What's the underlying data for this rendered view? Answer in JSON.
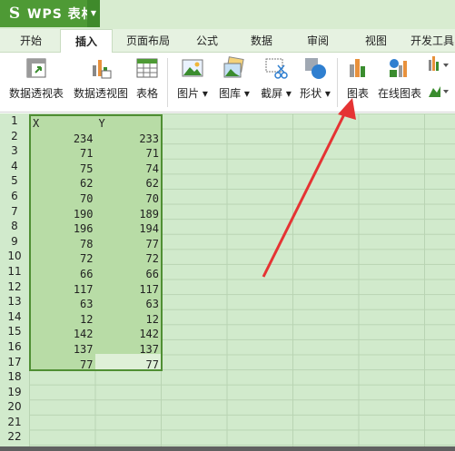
{
  "app": {
    "title": "WPS 表格",
    "logo": "S"
  },
  "tabs": [
    "开始",
    "插入",
    "页面布局",
    "公式",
    "数据",
    "审阅",
    "视图",
    "开发工具"
  ],
  "active_tab": "插入",
  "ribbon": {
    "pivot_table": "数据透视表",
    "pivot_chart": "数据透视图",
    "table": "表格",
    "picture": "图片",
    "gallery": "图库",
    "screenshot": "截屏",
    "shape": "形状",
    "chart": "图表",
    "online_chart": "在线图表",
    "dropdown_caret": "▾"
  },
  "sheet": {
    "row_numbers": [
      "1",
      "2",
      "3",
      "4",
      "5",
      "6",
      "7",
      "8",
      "9",
      "10",
      "11",
      "12",
      "13",
      "14",
      "15",
      "16",
      "17",
      "18",
      "19",
      "20",
      "21",
      "22"
    ],
    "headers": [
      "X",
      "Y"
    ],
    "rows": [
      [
        "234",
        "233"
      ],
      [
        "71",
        "71"
      ],
      [
        "75",
        "74"
      ],
      [
        "62",
        "62"
      ],
      [
        "70",
        "70"
      ],
      [
        "190",
        "189"
      ],
      [
        "196",
        "194"
      ],
      [
        "78",
        "77"
      ],
      [
        "72",
        "72"
      ],
      [
        "66",
        "66"
      ],
      [
        "117",
        "117"
      ],
      [
        "63",
        "63"
      ],
      [
        "12",
        "12"
      ],
      [
        "142",
        "142"
      ],
      [
        "137",
        "137"
      ],
      [
        "77",
        "77"
      ]
    ]
  },
  "colors": {
    "accent": "#4e9a35",
    "arrow": "#e53333",
    "sheet_bg": "#d1eacc",
    "selection": "#b8dca6"
  }
}
